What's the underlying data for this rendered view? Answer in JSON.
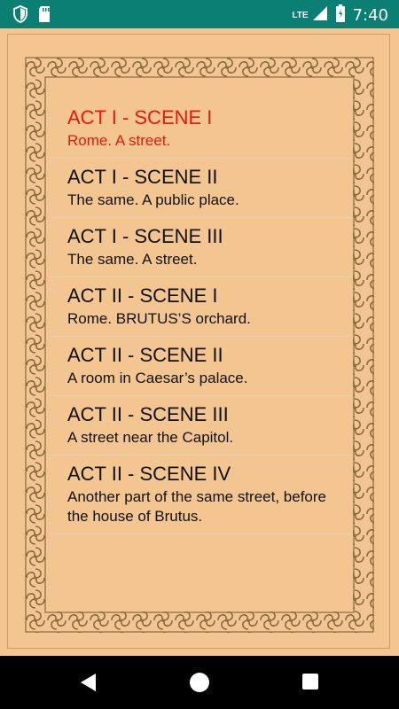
{
  "status_bar": {
    "network": "LTE",
    "time": "7:40",
    "icons": [
      "shield-icon",
      "sd-card-icon",
      "lte-signal-icon",
      "battery-icon"
    ]
  },
  "scenes": [
    {
      "act": "ACT I - SCENE I",
      "description": "Rome. A street.",
      "selected": true
    },
    {
      "act": "ACT I - SCENE II",
      "description": "The same. A public place.",
      "selected": false
    },
    {
      "act": "ACT I - SCENE III",
      "description": "The same. A street.",
      "selected": false
    },
    {
      "act": "ACT II - SCENE I",
      "description": "Rome. BRUTUS’S orchard.",
      "selected": false
    },
    {
      "act": "ACT II - SCENE II",
      "description": "A room in Caesar’s palace.",
      "selected": false
    },
    {
      "act": "ACT II - SCENE III",
      "description": "A street near the Capitol.",
      "selected": false
    },
    {
      "act": "ACT II - SCENE IV",
      "description": "Another part of the same street, before the house of Brutus.",
      "selected": false
    }
  ],
  "colors": {
    "status_bar": "#0b7f73",
    "background": "#f2c591",
    "selected_text": "#e8180e",
    "ornament": "#8a6a3a"
  },
  "nav_bar": {
    "icons": [
      "back-icon",
      "home-icon",
      "recents-icon"
    ]
  }
}
